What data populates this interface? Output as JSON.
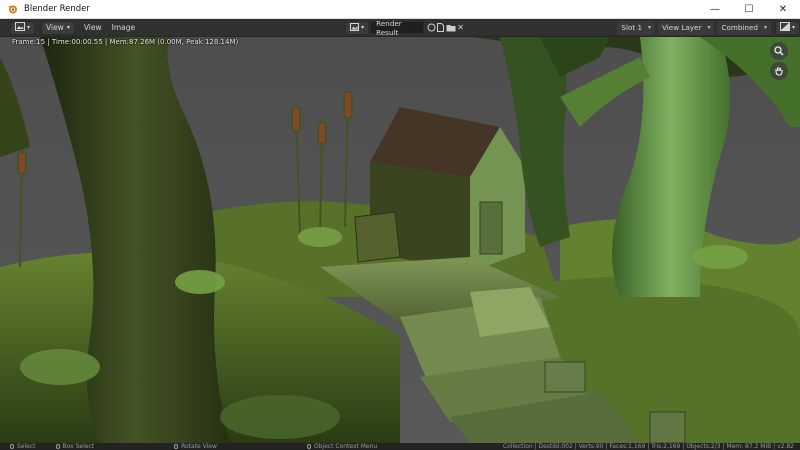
{
  "window": {
    "title": "Blender Render",
    "app_icon": "blender-logo-icon",
    "controls": {
      "minimize": "—",
      "maximize": "☐",
      "close": "✕"
    }
  },
  "header": {
    "editor_type_icon": "image-editor-icon",
    "view_dropdown": "View",
    "menus": [
      "View",
      "Image"
    ],
    "image_browse_icon": "image-browse-icon",
    "image_name": "Render Result",
    "slot": "Slot 1",
    "view_layer": "View Layer",
    "pass": "Combined",
    "display_icon": "display-channels-icon"
  },
  "viewport": {
    "frame_info": "Frame:15 | Time:00:00.55 | Mem:87.26M (0.00M, Peak 128.14M)",
    "zoom_icon": "zoom-icon",
    "hand_icon": "hand-pan-icon"
  },
  "statusbar": {
    "items": [
      "Select",
      "Box Select",
      "Rotate View",
      "Object Context Menu"
    ],
    "stats": "Collection | Destibl.002 | Verts:90 | Faces:1,169 | Tris:2,169 | Objects:2/3 | Mem: 87.2 MiB | v2.82"
  },
  "colors": {
    "title_bg": "#ffffff",
    "header_bg": "#303030",
    "viewport_bg": "#5a5a5a",
    "status_bg": "#232323"
  }
}
